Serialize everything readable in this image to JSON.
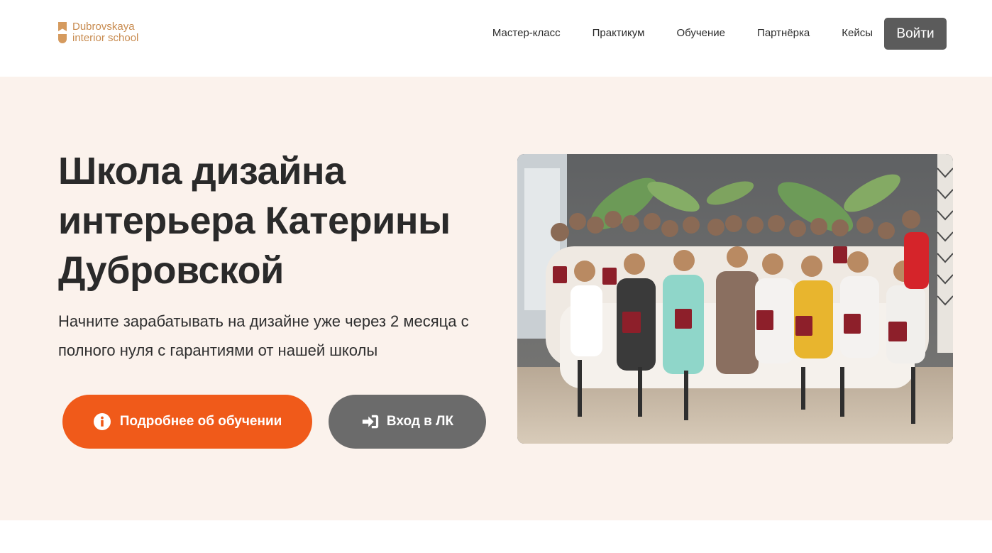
{
  "header": {
    "logo_line1": "Dubrovskaya",
    "logo_line2": "interior school",
    "nav": [
      {
        "label": "Мастер-класс"
      },
      {
        "label": "Практикум"
      },
      {
        "label": "Обучение"
      },
      {
        "label": "Партнёрка"
      },
      {
        "label": "Кейсы"
      }
    ],
    "login_label": "Войти"
  },
  "hero": {
    "title": "Школа дизайна интерьера Катерины Дубровской",
    "subtitle": "Начните зарабатывать на дизайне уже через 2 месяца с полного нуля с гарантиями от нашей школы",
    "primary_button": {
      "label": "Подробнее об обучении",
      "icon": "info-icon"
    },
    "secondary_button": {
      "label": "Вход в ЛК",
      "icon": "sign-in-icon"
    },
    "photo": {
      "description_icon": "group-photo"
    }
  },
  "colors": {
    "accent": "#f05a1a",
    "brand": "#c88b4f",
    "hero_bg": "#fbf2ec",
    "dark_button": "#5b5b5b",
    "secondary_button": "#6b6b6b"
  }
}
